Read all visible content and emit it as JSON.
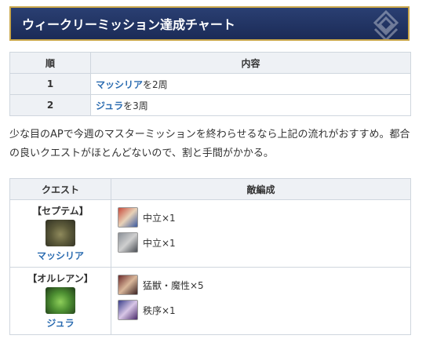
{
  "title": "ウィークリーミッション達成チャート",
  "order_table": {
    "headers": [
      "順",
      "内容"
    ],
    "rows": [
      {
        "num": "1",
        "link": "マッシリア",
        "suffix": "を2周"
      },
      {
        "num": "2",
        "link": "ジュラ",
        "suffix": "を3周"
      }
    ]
  },
  "paragraph": "少な目のAPで今週のマスターミッションを終わらせるなら上記の流れがおすすめ。都合の良いクエストがほとんどないので、割と手間がかかる。",
  "quest_table": {
    "headers": [
      "クエスト",
      "敵編成"
    ],
    "rows": [
      {
        "region": "【セプテム】",
        "quest": "マッシリア",
        "enemies": [
          {
            "label": "中立×1",
            "icon": "servant-portrait-icon"
          },
          {
            "label": "中立×1",
            "icon": "servant-portrait-icon"
          }
        ]
      },
      {
        "region": "【オルレアン】",
        "quest": "ジュラ",
        "enemies": [
          {
            "label": "猛獣・魔性×5",
            "icon": "enemy-portrait-icon"
          },
          {
            "label": "秩序×1",
            "icon": "servant-portrait-icon"
          }
        ]
      }
    ]
  }
}
